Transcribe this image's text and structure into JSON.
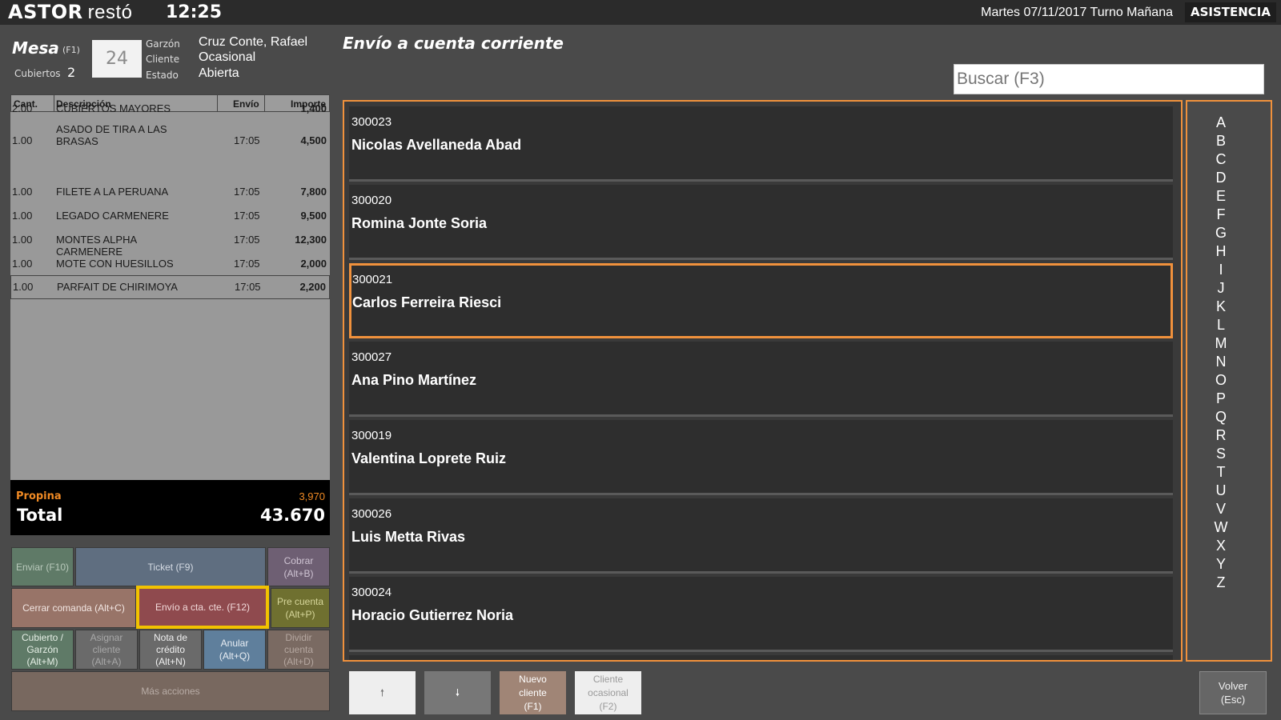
{
  "header": {
    "logo_brand": "ASTOR",
    "logo_product": "restó",
    "time": "12:25",
    "date_shift": "Martes 07/11/2017 Turno Mañana",
    "assist_button": "ASISTENCIA"
  },
  "table_info": {
    "mesa_label": "Mesa",
    "mesa_key": "(F1)",
    "mesa_number": "24",
    "cubiertos_label": "Cubiertos",
    "cubiertos_value": "2",
    "garzon_label": "Garzón",
    "garzon_value": "Cruz Conte, Rafael",
    "cliente_label": "Cliente",
    "cliente_value": "Ocasional",
    "estado_label": "Estado",
    "estado_value": "Abierta"
  },
  "order": {
    "headers": {
      "cant": "Cant.",
      "desc": "Descripción",
      "envio": "Envío",
      "importe": "Importe"
    },
    "rows": [
      {
        "cant": "2.00",
        "desc": "CUBIERTOS MAYORES",
        "envio": "",
        "importe": "1,400"
      },
      {
        "cant": "1.00",
        "desc": "ASADO DE TIRA A LAS BRASAS",
        "envio": "17:05",
        "importe": "4,500"
      },
      {
        "cant": "1.00",
        "desc": "FILETE A LA PERUANA",
        "envio": "17:05",
        "importe": "7,800"
      },
      {
        "cant": "1.00",
        "desc": "LEGADO CARMENERE",
        "envio": "17:05",
        "importe": "9,500"
      },
      {
        "cant": "1.00",
        "desc": "MONTES ALPHA CARMENERE",
        "envio": "17:05",
        "importe": "12,300"
      },
      {
        "cant": "1.00",
        "desc": "MOTE CON HUESILLOS",
        "envio": "17:05",
        "importe": "2,000"
      },
      {
        "cant": "1.00",
        "desc": "PARFAIT DE CHIRIMOYA",
        "envio": "17:05",
        "importe": "2,200"
      }
    ],
    "propina_label": "Propina",
    "propina_value": "3,970",
    "total_label": "Total",
    "total_value": "43.670"
  },
  "actions": {
    "enviar": "Enviar (F10)",
    "ticket": "Ticket (F9)",
    "cobrar": "Cobrar\n(Alt+B)",
    "cerrar": "Cerrar comanda (Alt+C)",
    "envio_cta": "Envío a cta. cte. (F12)",
    "pre_cuenta": "Pre cuenta\n(Alt+P)",
    "cubierto_garzon": "Cubierto /\nGarzón\n(Alt+M)",
    "asignar_cliente": "Asignar\ncliente\n(Alt+A)",
    "nota_credito": "Nota de\ncrédito\n(Alt+N)",
    "anular": "Anular\n(Alt+Q)",
    "dividir": "Dividir\ncuenta\n(Alt+D)",
    "mas_acciones": "Más acciones"
  },
  "panel": {
    "title": "Envío a cuenta corriente",
    "search_placeholder": "Buscar (F3)",
    "clients": [
      {
        "code": "300023",
        "name": "Nicolas Avellaneda Abad"
      },
      {
        "code": "300020",
        "name": "Romina Jonte Soria"
      },
      {
        "code": "300021",
        "name": "Carlos Ferreira Riesci"
      },
      {
        "code": "300027",
        "name": "Ana Pino Martínez"
      },
      {
        "code": "300019",
        "name": "Valentina Loprete Ruiz"
      },
      {
        "code": "300026",
        "name": "Luis Metta Rivas"
      },
      {
        "code": "300024",
        "name": "Horacio Gutierrez Noria"
      }
    ],
    "selected_index": 2,
    "letters": [
      "A",
      "B",
      "C",
      "D",
      "E",
      "F",
      "G",
      "H",
      "I",
      "J",
      "K",
      "L",
      "M",
      "N",
      "O",
      "P",
      "Q",
      "R",
      "S",
      "T",
      "U",
      "V",
      "W",
      "X",
      "Y",
      "Z"
    ],
    "up_arrow": "🠕",
    "down_arrow": "🠗",
    "nuevo_cliente": "Nuevo\ncliente\n(F1)",
    "cliente_ocasional": "Cliente\nocasional\n(F2)",
    "volver": "Volver\n(Esc)"
  },
  "colors": {
    "accent": "#f0913c",
    "highlight": "#f2c200"
  }
}
